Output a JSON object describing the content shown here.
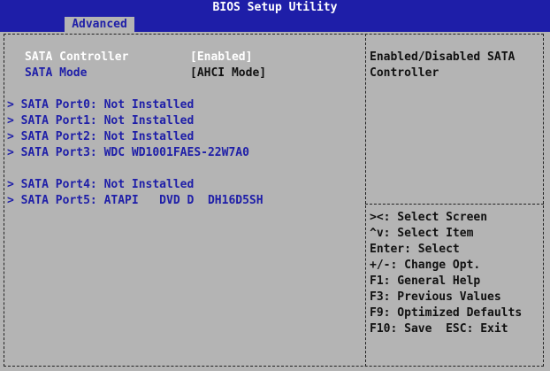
{
  "title": "BIOS Setup Utility",
  "tabs": [
    {
      "label": "Advanced",
      "selected": true
    }
  ],
  "settings": [
    {
      "label": "SATA Controller",
      "value": "[Enabled]",
      "selected": true
    },
    {
      "label": "SATA Mode",
      "value": "[AHCI Mode]",
      "selected": false
    }
  ],
  "ports": [
    "> SATA Port0: Not Installed",
    "> SATA Port1: Not Installed",
    "> SATA Port2: Not Installed",
    "> SATA Port3: WDC WD1001FAES-22W7A0",
    "> SATA Port4: Not Installed",
    "> SATA Port5: ATAPI   DVD D  DH16D5SH"
  ],
  "help_text": [
    "Enabled/Disabled SATA",
    "Controller"
  ],
  "key_help": [
    "><: Select Screen",
    "^v: Select Item",
    "Enter: Select",
    "+/-: Change Opt.",
    "F1: General Help",
    "F3: Previous Values",
    "F9: Optimized Defaults",
    "F10: Save  ESC: Exit"
  ],
  "colors": {
    "background": "#b4b4b4",
    "accent": "#1e1ea8",
    "highlight": "#ffffff"
  }
}
